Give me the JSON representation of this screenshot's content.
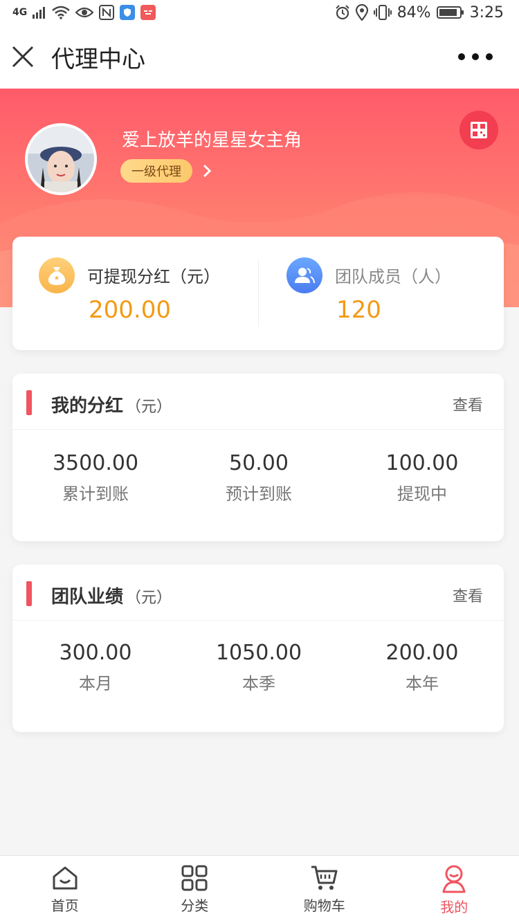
{
  "status": {
    "network": "4G",
    "battery": "84%",
    "time": "3:25"
  },
  "header": {
    "title": "代理中心"
  },
  "profile": {
    "name": "爱上放羊的星星女主角",
    "level": "一级代理"
  },
  "summary": {
    "withdrawable_label": "可提现分红（元）",
    "withdrawable_value": "200.00",
    "team_label": "团队成员（人）",
    "team_value": "120"
  },
  "dividend": {
    "title": "我的分红",
    "unit": "（元）",
    "view": "查看",
    "stats": [
      {
        "value": "3500.00",
        "label": "累计到账"
      },
      {
        "value": "50.00",
        "label": "预计到账"
      },
      {
        "value": "100.00",
        "label": "提现中"
      }
    ]
  },
  "team": {
    "title": "团队业绩",
    "unit": "（元）",
    "view": "查看",
    "stats": [
      {
        "value": "300.00",
        "label": "本月"
      },
      {
        "value": "1050.00",
        "label": "本季"
      },
      {
        "value": "200.00",
        "label": "本年"
      }
    ]
  },
  "tabbar": {
    "items": [
      {
        "label": "首页",
        "icon": "home-icon"
      },
      {
        "label": "分类",
        "icon": "category-icon"
      },
      {
        "label": "购物车",
        "icon": "cart-icon"
      },
      {
        "label": "我的",
        "icon": "profile-icon"
      }
    ],
    "active_index": 3
  },
  "colors": {
    "accent": "#f0545f",
    "gold": "#f39a14",
    "hero_top": "#ff5b6a",
    "hero_bottom": "#ff8d74"
  }
}
